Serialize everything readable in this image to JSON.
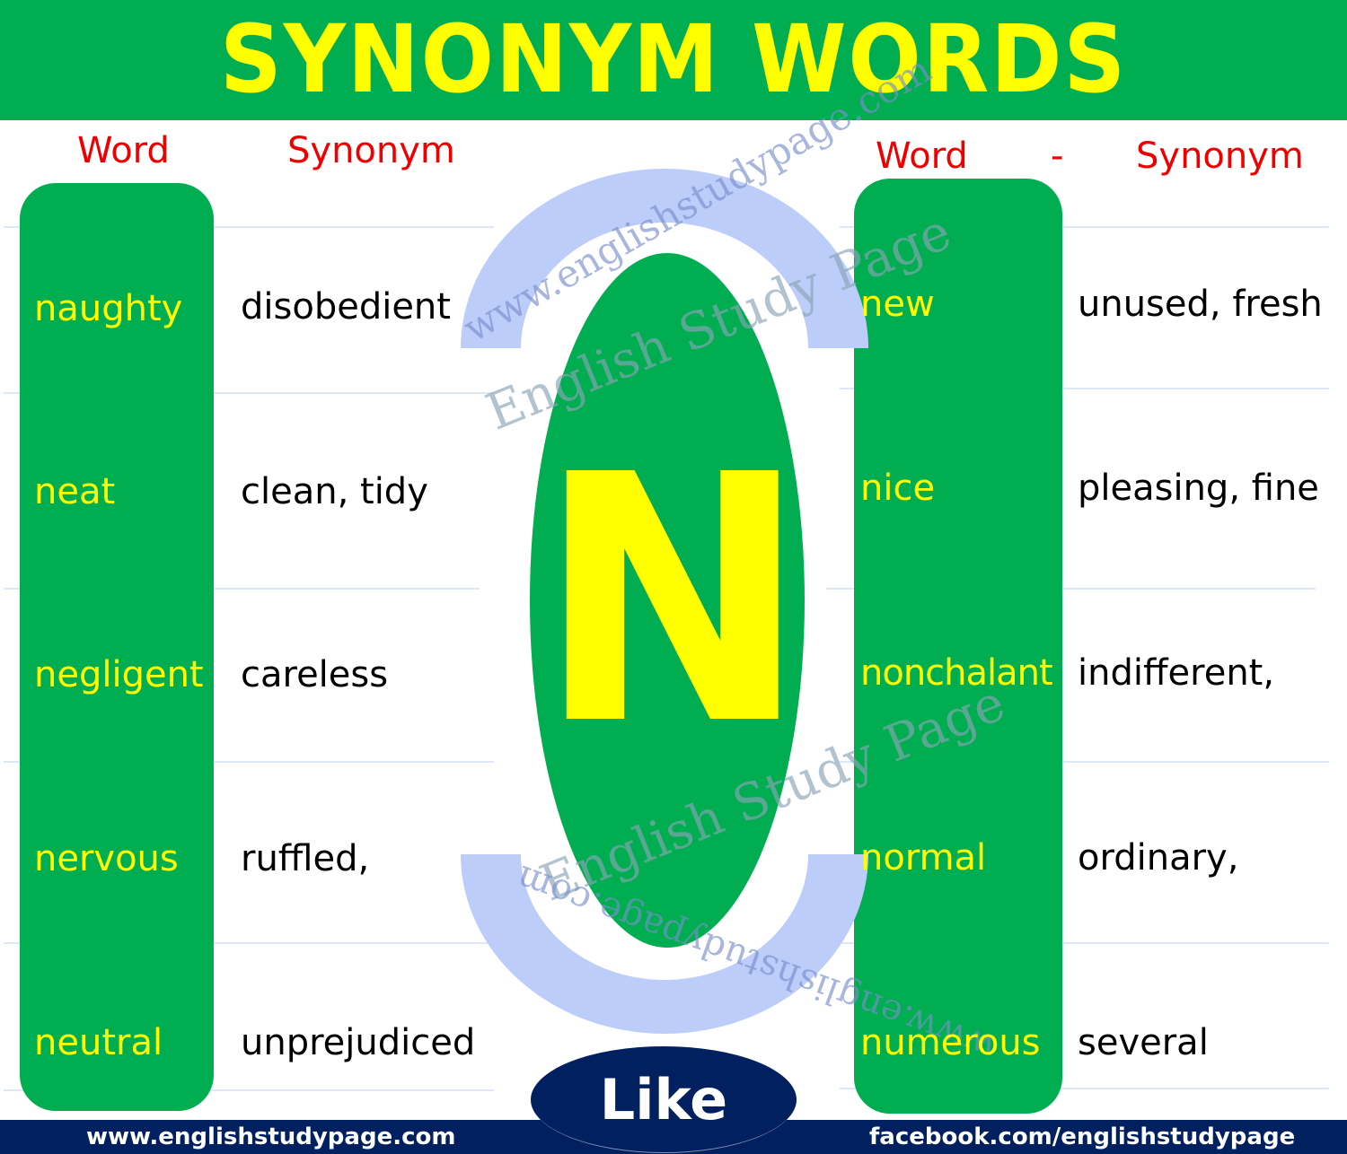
{
  "header": {
    "title": "SYNONYM WORDS"
  },
  "left_table": {
    "headers": {
      "word": "Word",
      "synonym": "Synonym"
    },
    "rows": [
      {
        "word": "naughty",
        "synonym": "disobedient"
      },
      {
        "word": "neat",
        "synonym": "clean, tidy"
      },
      {
        "word": "negligent",
        "synonym": "careless"
      },
      {
        "word": "nervous",
        "synonym": "ruffled,"
      },
      {
        "word": "neutral",
        "synonym": "unprejudiced"
      }
    ]
  },
  "right_table": {
    "headers": {
      "word": "Word",
      "separator": "-",
      "synonym": "Synonym"
    },
    "rows": [
      {
        "word": "new",
        "synonym": "unused, fresh"
      },
      {
        "word": "nice",
        "synonym": "pleasing, fine"
      },
      {
        "word": "nonchalant",
        "synonym": "indifferent,"
      },
      {
        "word": "normal",
        "synonym": "ordinary,"
      },
      {
        "word": "numerous",
        "synonym": "several"
      }
    ]
  },
  "center": {
    "letter": "N",
    "watermark_url": "www.englishstudypage.com",
    "watermark_name": "English Study Page"
  },
  "like_button": {
    "label": "Like"
  },
  "footer": {
    "website": "www.englishstudypage.com",
    "facebook": "facebook.com/englishstudypage"
  },
  "colors": {
    "green": "#00ad50",
    "yellow": "#ffff00",
    "red": "#ee0000",
    "navy": "#002060",
    "watermark_blue": "#bccdfa"
  }
}
